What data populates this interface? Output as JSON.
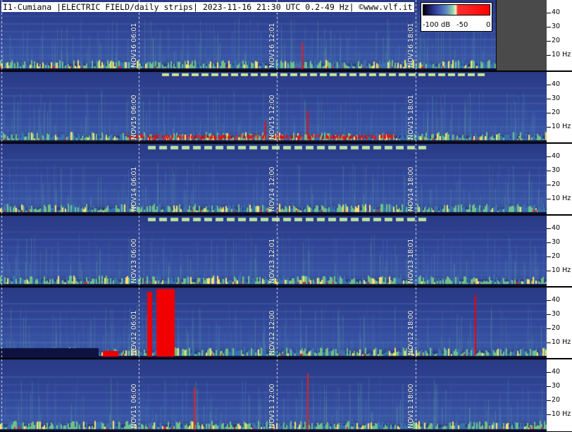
{
  "title": "I1-Cumiana |ELECTRIC FIELD/daily strips| 2023-11-16 21:30 UTC 0.2-49 Hz| ©www.vlf.it",
  "colorbar": {
    "labels": [
      "-100 dB",
      "-50",
      "0"
    ]
  },
  "axis": {
    "ticks": [
      "40",
      "30",
      "20",
      "10 Hz"
    ]
  },
  "strips": [
    {
      "id": "nov16",
      "labels": [
        "NOV16 06:01",
        "NOV16 12:01",
        "NOV16 18:01"
      ],
      "partial": true
    },
    {
      "id": "nov15",
      "labels": [
        "NOV15 06:00",
        "NOV15 12:00",
        "NOV15 18:01"
      ],
      "partial": false
    },
    {
      "id": "nov14",
      "labels": [
        "NOV14 06:01",
        "NOV14 12:00",
        "NOV14 18:00"
      ],
      "partial": false
    },
    {
      "id": "nov13",
      "labels": [
        "NOV13 06:00",
        "NOV13 12:01",
        "NOV13 18:01"
      ],
      "partial": false
    },
    {
      "id": "nov12",
      "labels": [
        "NOV12 06:01",
        "NOV12 12:00",
        "NOV12 18:00"
      ],
      "partial": false
    },
    {
      "id": "nov11",
      "labels": [
        "NOV11 06:00",
        "NOV11 12:00",
        "NOV11 18:00"
      ],
      "partial": false
    }
  ]
}
